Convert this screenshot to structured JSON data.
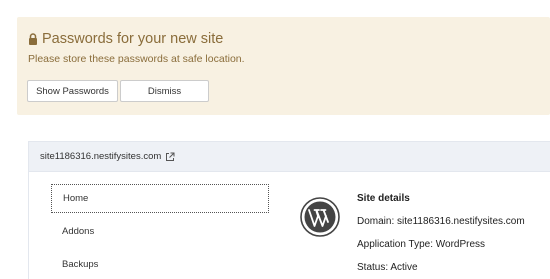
{
  "notice": {
    "title": "Passwords for your new site",
    "message": "Please store these passwords at safe location.",
    "show_passwords_label": "Show Passwords",
    "dismiss_label": "Dismiss",
    "icon": "lock-icon",
    "text_color": "#8a6d3b",
    "background_color": "#f8f1e2"
  },
  "site": {
    "domain_link": "site1186316.nestifysites.com",
    "link_icon": "external-link-icon",
    "nav": {
      "items": [
        {
          "label": "Home"
        },
        {
          "label": "Addons"
        },
        {
          "label": "Backups"
        }
      ],
      "active": "Home"
    },
    "logo_icon": "wordpress-logo-icon",
    "details": {
      "title": "Site details",
      "domain": "Domain: site1186316.nestifysites.com",
      "application_type": "Application Type: WordPress",
      "status": "Status: Active"
    }
  }
}
